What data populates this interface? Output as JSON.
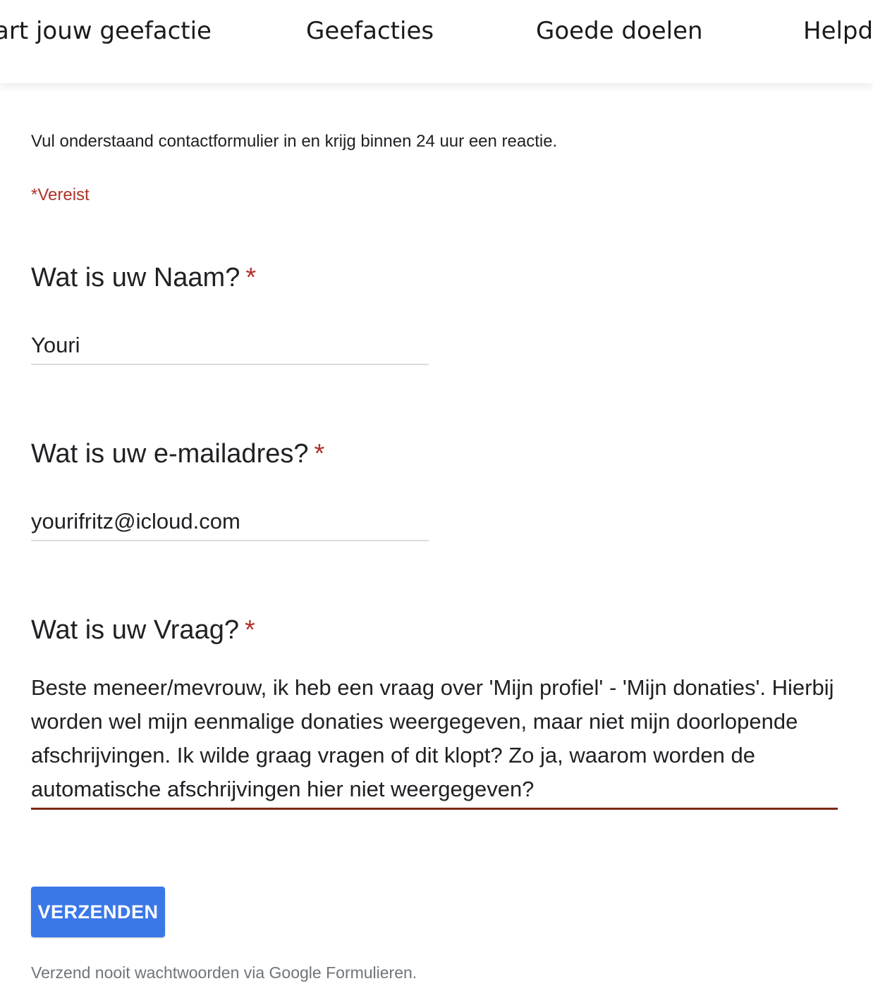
{
  "nav": {
    "items": [
      "art jouw geefactie",
      "Geefacties",
      "Goede doelen",
      "Helpde"
    ]
  },
  "form": {
    "intro": "Vul onderstaand contactformulier in en krijg binnen 24 uur een reactie.",
    "required_note": "*Vereist",
    "required_marker": "*",
    "questions": [
      {
        "label": "Wat is uw Naam?",
        "value": "Youri"
      },
      {
        "label": "Wat is uw e-mailadres?",
        "value": "yourifritz@icloud.com"
      },
      {
        "label": "Wat is uw Vraag?",
        "value": "Beste meneer/mevrouw, ik heb een vraag over 'Mijn profiel' - 'Mijn donaties'. Hierbij worden wel mijn eenmalige donaties weergegeven, maar niet mijn doorlopende afschrijvingen. Ik wilde graag vragen of dit klopt? Zo ja, waarom worden de automatische afschrijvingen hier niet weergegeven?"
      }
    ],
    "submit_label": "VERZENDEN",
    "footer_note": "Verzend nooit wachtwoorden via Google Formulieren."
  },
  "colors": {
    "accent": "#3b78e7",
    "required": "#b0322a",
    "active_underline": "#7a2716"
  }
}
